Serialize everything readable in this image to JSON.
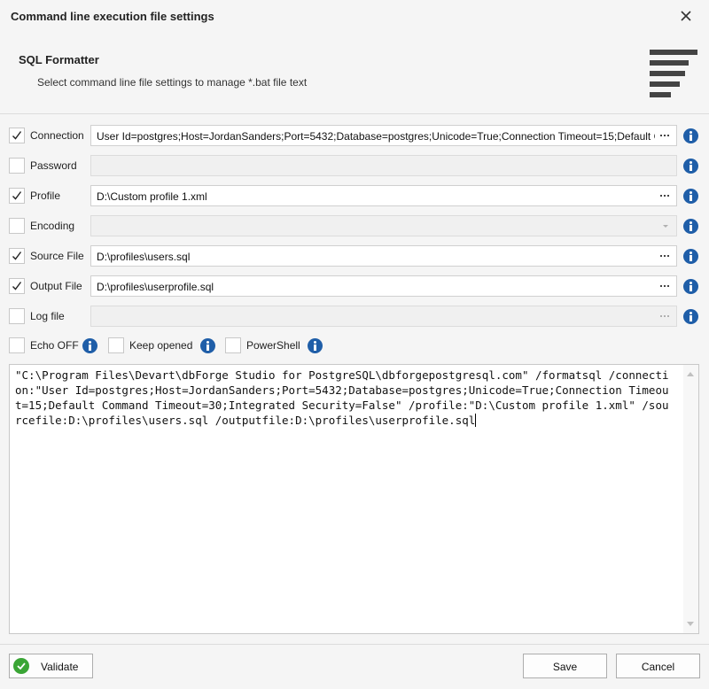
{
  "window": {
    "title": "Command line execution file settings"
  },
  "header": {
    "section_title": "SQL Formatter",
    "description": "Select command line file settings to manage *.bat file text"
  },
  "settings": [
    {
      "label": "Connection",
      "checked": true,
      "value": "User Id=postgres;Host=JordanSanders;Port=5432;Database=postgres;Unicode=True;Connection Timeout=15;Default Command Timeout=30;Integrated Security=False",
      "enabled": true,
      "control": "browse"
    },
    {
      "label": "Password",
      "checked": false,
      "value": "",
      "enabled": false,
      "control": "none"
    },
    {
      "label": "Profile",
      "checked": true,
      "value": "D:\\Custom profile 1.xml",
      "enabled": true,
      "control": "browse"
    },
    {
      "label": "Encoding",
      "checked": false,
      "value": "",
      "enabled": false,
      "control": "dropdown"
    },
    {
      "label": "Source File",
      "checked": true,
      "value": "D:\\profiles\\users.sql",
      "enabled": true,
      "control": "browse"
    },
    {
      "label": "Output File",
      "checked": true,
      "value": "D:\\profiles\\userprofile.sql",
      "enabled": true,
      "control": "browse"
    },
    {
      "label": "Log file",
      "checked": false,
      "value": "",
      "enabled": false,
      "control": "browse"
    }
  ],
  "options": {
    "echo_off": {
      "label": "Echo OFF",
      "checked": false
    },
    "keep_opened": {
      "label": "Keep opened",
      "checked": false
    },
    "powershell": {
      "label": "PowerShell",
      "checked": false
    }
  },
  "command_text": "\"C:\\Program Files\\Devart\\dbForge Studio for PostgreSQL\\dbforgepostgresql.com\" /formatsql /connection:\"User Id=postgres;Host=JordanSanders;Port=5432;Database=postgres;Unicode=True;Connection Timeout=15;Default Command Timeout=30;Integrated Security=False\" /profile:\"D:\\Custom profile 1.xml\" /sourcefile:D:\\profiles\\users.sql /outputfile:D:\\profiles\\userprofile.sql",
  "footer": {
    "validate_label": "Validate",
    "save_label": "Save",
    "cancel_label": "Cancel"
  },
  "colors": {
    "info_icon": "#1f5ea8",
    "validate_icon": "#3aa535",
    "background": "#f5f5f5"
  }
}
